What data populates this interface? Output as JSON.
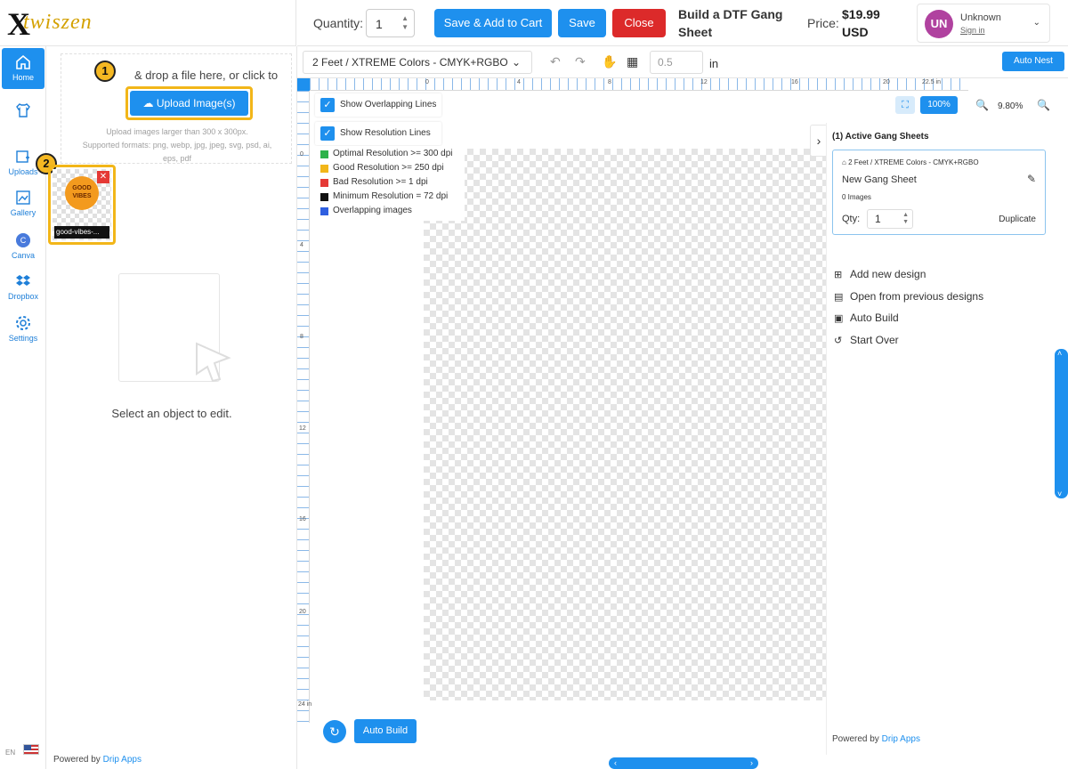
{
  "brand": {
    "logo_mark": "X",
    "logo_text": "twiszen"
  },
  "topbar": {
    "quantity_label": "Quantity:",
    "quantity_value": "1",
    "save_add_cart": "Save & Add to Cart",
    "save": "Save",
    "close": "Close",
    "title": "Build a DTF Gang Sheet",
    "price_label": "Price:",
    "price_value": "$19.99 USD",
    "user_initials": "UN",
    "user_name": "Unknown",
    "user_signin": "Sign in"
  },
  "nav": {
    "items": [
      {
        "label": "Home",
        "icon": "home-icon"
      },
      {
        "label": "",
        "icon": "tshirt-icon"
      },
      {
        "label": "Uploads",
        "icon": "upload-icon"
      },
      {
        "label": "Gallery",
        "icon": "gallery-icon"
      },
      {
        "label": "Canva",
        "icon": "canva-icon"
      },
      {
        "label": "Dropbox",
        "icon": "dropbox-icon"
      },
      {
        "label": "Settings",
        "icon": "gear-icon"
      }
    ],
    "language": "EN"
  },
  "upload_panel": {
    "drop_text": "& drop a file here, or click to",
    "upload_button": "Upload Image(s)",
    "hint_size": "Upload images larger than 300 x 300px.",
    "hint_formats": "Supported formats: png, webp, jpg, jpeg, svg, psd, ai, eps, pdf",
    "badge_1": "1",
    "badge_2": "2",
    "thumbnail_name": "good-vibes-...",
    "thumbnail_art_text": "GOOD VIBES",
    "select_message": "Select an object to edit.",
    "powered_prefix": "Powered by",
    "powered_link": "Drip Apps"
  },
  "canvas_toolbar": {
    "sheet_size": "2 Feet / XTREME Colors - CMYK+RGBO",
    "grid_value": "0.5",
    "unit": "in",
    "auto_nest": "Auto Nest"
  },
  "ruler": {
    "top_ticks": [
      "0",
      "4",
      "8",
      "12",
      "16",
      "20",
      "22.5 in"
    ],
    "left_ticks": [
      "0",
      "4",
      "8",
      "12",
      "16",
      "20",
      "24 in"
    ]
  },
  "overlay": {
    "show_overlapping": "Show Overlapping Lines",
    "show_resolution": "Show Resolution Lines",
    "legend": [
      {
        "label": "Optimal Resolution >= 300 dpi",
        "color": "#2eb24a"
      },
      {
        "label": "Good Resolution >= 250 dpi",
        "color": "#f2b619"
      },
      {
        "label": "Bad Resolution >= 1 dpi",
        "color": "#e53935"
      },
      {
        "label": "Minimum Resolution = 72 dpi",
        "color": "#111111"
      },
      {
        "label": "Overlapping images",
        "color": "#2f5fe0"
      }
    ]
  },
  "zoom": {
    "fit_icon": "fit-screen-icon",
    "reset": "100%",
    "percent": "9.80%"
  },
  "canvas_bottom": {
    "auto_build": "Auto Build"
  },
  "right_panel": {
    "active_title": "(1)  Active Gang Sheets",
    "sheet_path": "2 Feet / XTREME Colors - CMYK+RGBO",
    "sheet_name": "New Gang Sheet",
    "sheet_count": "0 Images",
    "qty_label": "Qty:",
    "qty_value": "1",
    "duplicate": "Duplicate",
    "actions": [
      {
        "label": "Add new design",
        "icon": "add-design-icon"
      },
      {
        "label": "Open from previous designs",
        "icon": "open-designs-icon"
      },
      {
        "label": "Auto Build",
        "icon": "auto-build-icon"
      },
      {
        "label": "Start Over",
        "icon": "restart-icon"
      }
    ],
    "powered_prefix": "Powered by",
    "powered_link": "Drip Apps"
  },
  "colors": {
    "accent": "#1e90ee",
    "danger": "#dc2a2a",
    "highlight": "#f2b619",
    "avatar": "#b0429f"
  }
}
